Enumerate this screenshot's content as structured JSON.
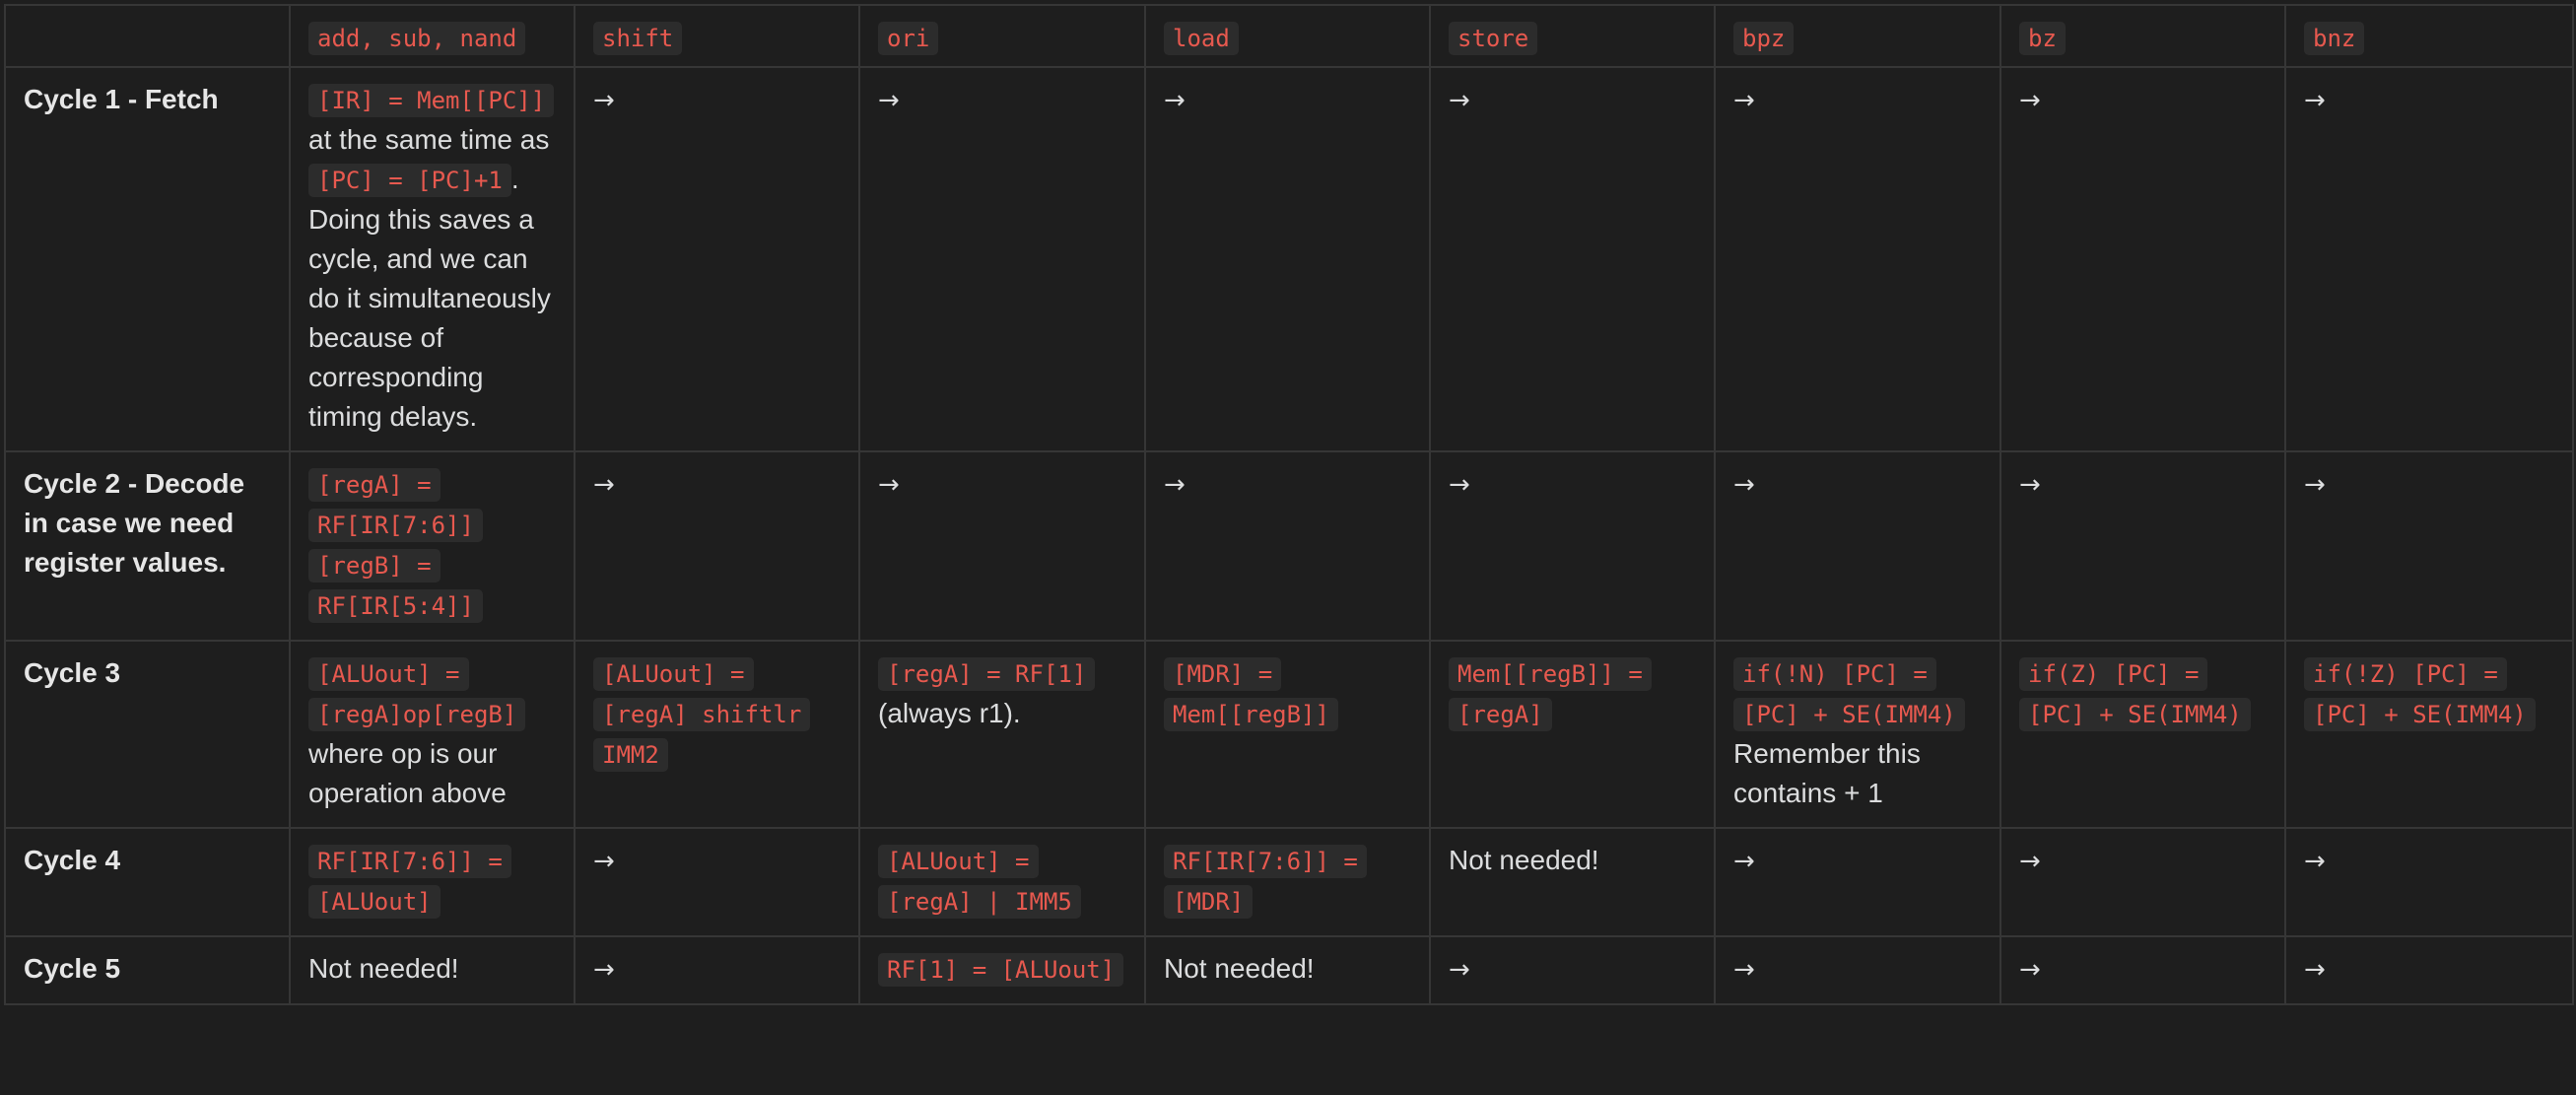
{
  "headers": [
    "",
    "add, sub, nand",
    "shift",
    "ori",
    "load",
    "store",
    "bpz",
    "bz",
    "bnz"
  ],
  "arrow": "→",
  "rows": [
    {
      "label": "Cycle 1 - Fetch",
      "cells": [
        [
          {
            "t": "code",
            "v": "[IR] = Mem[[PC]]"
          },
          {
            "t": "text",
            "v": " at the same time as "
          },
          {
            "t": "code",
            "v": "[PC] = [PC]+1"
          },
          {
            "t": "text",
            "v": ". Doing this saves a cycle, and we can do it simultaneously because of corresponding timing delays."
          }
        ],
        "arrow",
        "arrow",
        "arrow",
        "arrow",
        "arrow",
        "arrow",
        "arrow"
      ]
    },
    {
      "label": "Cycle 2 - Decode in case we need register values.",
      "cells": [
        [
          {
            "t": "code",
            "v": "[regA] = RF[IR[7:6]]"
          },
          {
            "t": "text",
            "v": " "
          },
          {
            "t": "code",
            "v": "[regB] = RF[IR[5:4]]"
          }
        ],
        "arrow",
        "arrow",
        "arrow",
        "arrow",
        "arrow",
        "arrow",
        "arrow"
      ]
    },
    {
      "label": "Cycle 3",
      "cells": [
        [
          {
            "t": "code",
            "v": "[ALUout] = [regA]op[regB]"
          },
          {
            "t": "text",
            "v": " where op is our operation above"
          }
        ],
        [
          {
            "t": "code",
            "v": "[ALUout] = [regA] shiftlr IMM2"
          }
        ],
        [
          {
            "t": "code",
            "v": "[regA] = RF[1]"
          },
          {
            "t": "text",
            "v": " (always r1)."
          }
        ],
        [
          {
            "t": "code",
            "v": "[MDR] = Mem[[regB]]"
          }
        ],
        [
          {
            "t": "code",
            "v": "Mem[[regB]] = [regA]"
          }
        ],
        [
          {
            "t": "code",
            "v": "if(!N) [PC] = [PC] + SE(IMM4)"
          },
          {
            "t": "text",
            "v": " Remember this contains + 1"
          }
        ],
        [
          {
            "t": "code",
            "v": "if(Z) [PC] = [PC] + SE(IMM4)"
          }
        ],
        [
          {
            "t": "code",
            "v": "if(!Z) [PC] = [PC] + SE(IMM4)"
          }
        ]
      ]
    },
    {
      "label": "Cycle 4",
      "cells": [
        [
          {
            "t": "code",
            "v": "RF[IR[7:6]] = [ALUout]"
          }
        ],
        "arrow",
        [
          {
            "t": "code",
            "v": "[ALUout] = [regA] | IMM5"
          }
        ],
        [
          {
            "t": "code",
            "v": "RF[IR[7:6]] = [MDR]"
          }
        ],
        [
          {
            "t": "text",
            "v": "Not needed!"
          }
        ],
        "arrow",
        "arrow",
        "arrow"
      ]
    },
    {
      "label": "Cycle 5",
      "cells": [
        [
          {
            "t": "text",
            "v": "Not needed!"
          }
        ],
        "arrow",
        [
          {
            "t": "code",
            "v": "RF[1] = [ALUout]"
          }
        ],
        [
          {
            "t": "text",
            "v": "Not needed!"
          }
        ],
        "arrow",
        "arrow",
        "arrow",
        "arrow"
      ]
    }
  ]
}
